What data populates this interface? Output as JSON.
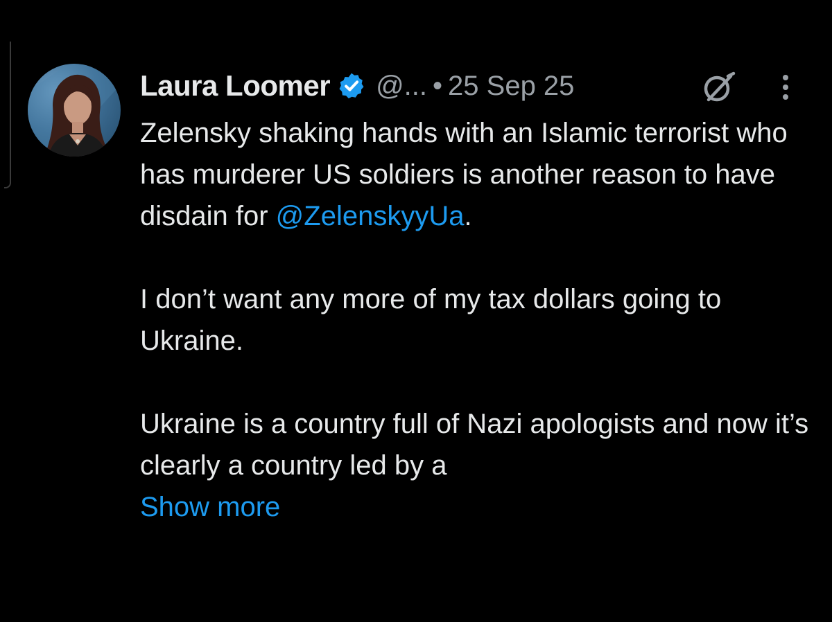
{
  "tweet": {
    "author_name": "Laura Loomer",
    "handle": "@...",
    "separator": "•",
    "date": "25 Sep 25",
    "verified": true,
    "paragraph1_text": "Zelensky shaking hands with an Islamic terrorist who has murderer US soldiers is another reason to have disdain for ",
    "mention": "@ZelenskyyUa",
    "paragraph1_end": ".",
    "paragraph2": "I don’t want any more of my tax dollars going to Ukraine.",
    "paragraph3": "Ukraine is a country full of Nazi apologists and now it’s clearly a country led by a",
    "show_more": "Show more"
  },
  "icons": {
    "verified": "verified-badge-icon",
    "grok": "grok-icon",
    "more": "more-options-icon"
  },
  "colors": {
    "background": "#000000",
    "text": "#e7e9ea",
    "secondary": "#9aa0a6",
    "accent": "#1d9bf0"
  }
}
